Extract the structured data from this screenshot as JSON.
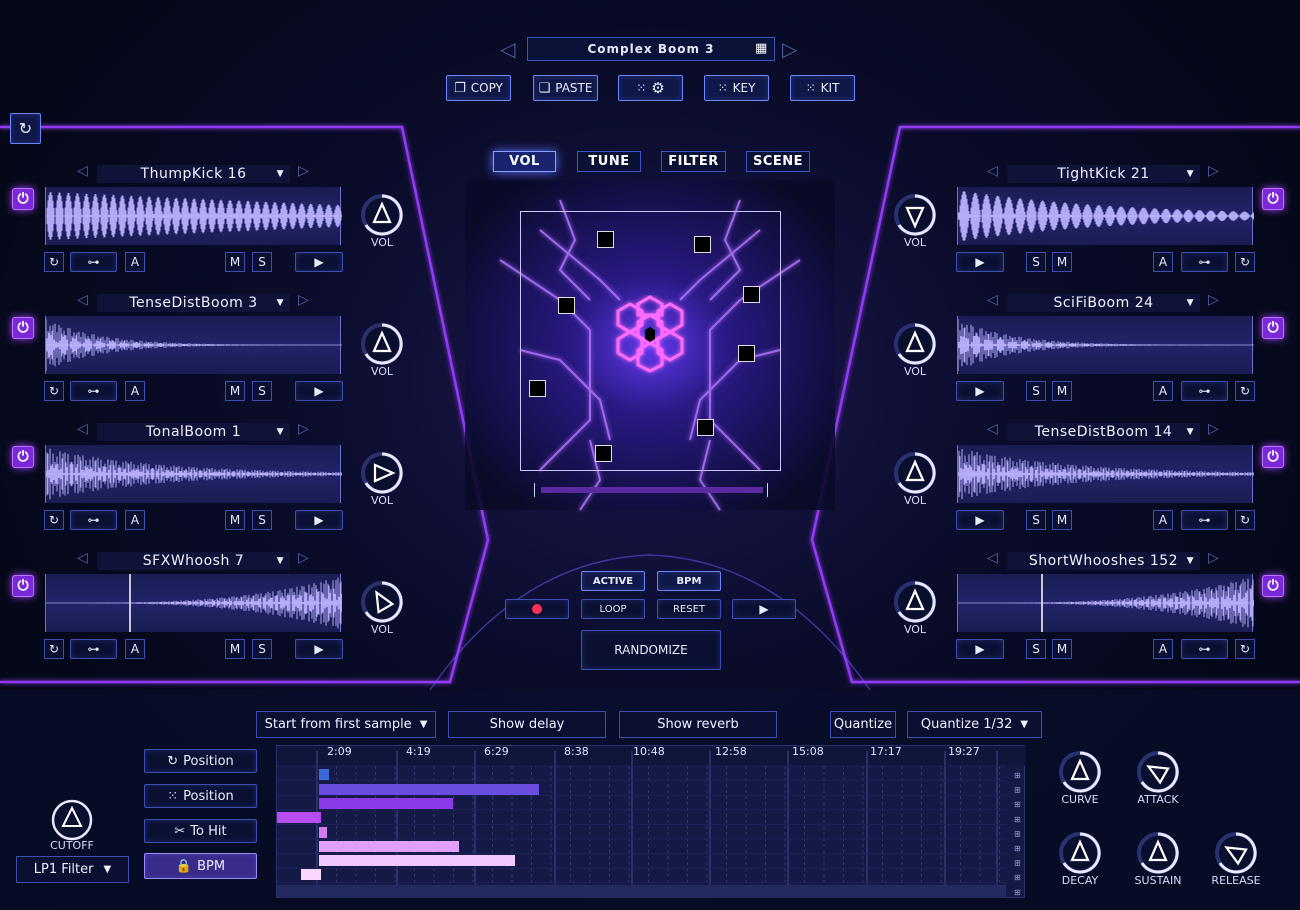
{
  "preset": {
    "name": "Complex Boom 3"
  },
  "toolbar": {
    "copy": "COPY",
    "paste": "PASTE",
    "key": "KEY",
    "kit": "KIT"
  },
  "tabs": [
    "VOL",
    "TUNE",
    "FILTER",
    "SCENE"
  ],
  "left_slots": [
    {
      "name": "ThumpKick 16",
      "knob": "VOL"
    },
    {
      "name": "TenseDistBoom 3",
      "knob": "VOL"
    },
    {
      "name": "TonalBoom 1",
      "knob": "VOL"
    },
    {
      "name": "SFXWhoosh 7",
      "knob": "VOL"
    }
  ],
  "right_slots": [
    {
      "name": "TightKick 21",
      "knob": "VOL"
    },
    {
      "name": "SciFiBoom 24",
      "knob": "VOL"
    },
    {
      "name": "TenseDistBoom 14",
      "knob": "VOL"
    },
    {
      "name": "ShortWhooshes 152",
      "knob": "VOL"
    }
  ],
  "slot_buttons": {
    "a": "A",
    "m": "M",
    "s": "S"
  },
  "transport": {
    "active": "ACTIVE",
    "bpm": "BPM",
    "loop": "LOOP",
    "reset": "RESET",
    "randomize": "RANDOMIZE"
  },
  "sequencer": {
    "start_mode": "Start from first sample",
    "show_delay": "Show delay",
    "show_reverb": "Show reverb",
    "quantize": "Quantize",
    "quantize_value": "Quantize 1/32",
    "timeline_labels": [
      "2:09",
      "4:19",
      "6:29",
      "8:38",
      "10:48",
      "12:58",
      "15:08",
      "17:17",
      "19:27"
    ],
    "bars_color": "#7a5cf0"
  },
  "side_buttons": {
    "position1": "Position",
    "position2": "Position",
    "to_hit": "To Hit",
    "bpm": "BPM"
  },
  "filter": {
    "knob": "CUTOFF",
    "type": "LP1 Filter"
  },
  "envelope": {
    "curve": "CURVE",
    "attack": "ATTACK",
    "decay": "DECAY",
    "sustain": "SUSTAIN",
    "release": "RELEASE"
  },
  "colors": {
    "accent": "#7b28d9",
    "border": "#3a4fb0",
    "glow": "#9a4cff"
  }
}
